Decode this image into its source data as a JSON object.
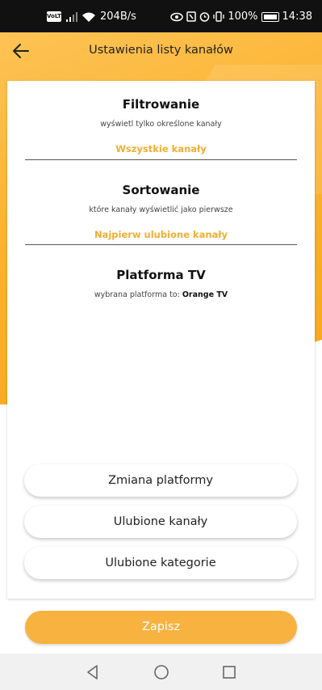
{
  "status_bar": {
    "volte": "VoLTE",
    "speed": "204B/s",
    "battery": "100%",
    "time": "14:38"
  },
  "header": {
    "title": "Ustawienia listy kanałów",
    "back_icon": "arrow-left-icon"
  },
  "filter": {
    "title": "Filtrowanie",
    "subtitle": "wyświetl tylko określone kanały",
    "value": "Wszystkie kanały"
  },
  "sorting": {
    "title": "Sortowanie",
    "subtitle": "które kanały wyświetlić jako pierwsze",
    "value": "Najpierw ulubione kanały"
  },
  "platform": {
    "title": "Platforma TV",
    "subtitle_prefix": "wybrana platforma to: ",
    "subtitle_value": "Orange TV"
  },
  "buttons": {
    "change_platform": "Zmiana platformy",
    "favorite_channels": "Ulubione kanały",
    "favorite_categories": "Ulubione kategorie",
    "save": "Zapisz"
  },
  "colors": {
    "accent": "#f8b240",
    "accent_text": "#f3ae31"
  },
  "nav": {
    "back_icon": "triangle-back-icon",
    "home_icon": "circle-home-icon",
    "recents_icon": "square-recents-icon"
  }
}
